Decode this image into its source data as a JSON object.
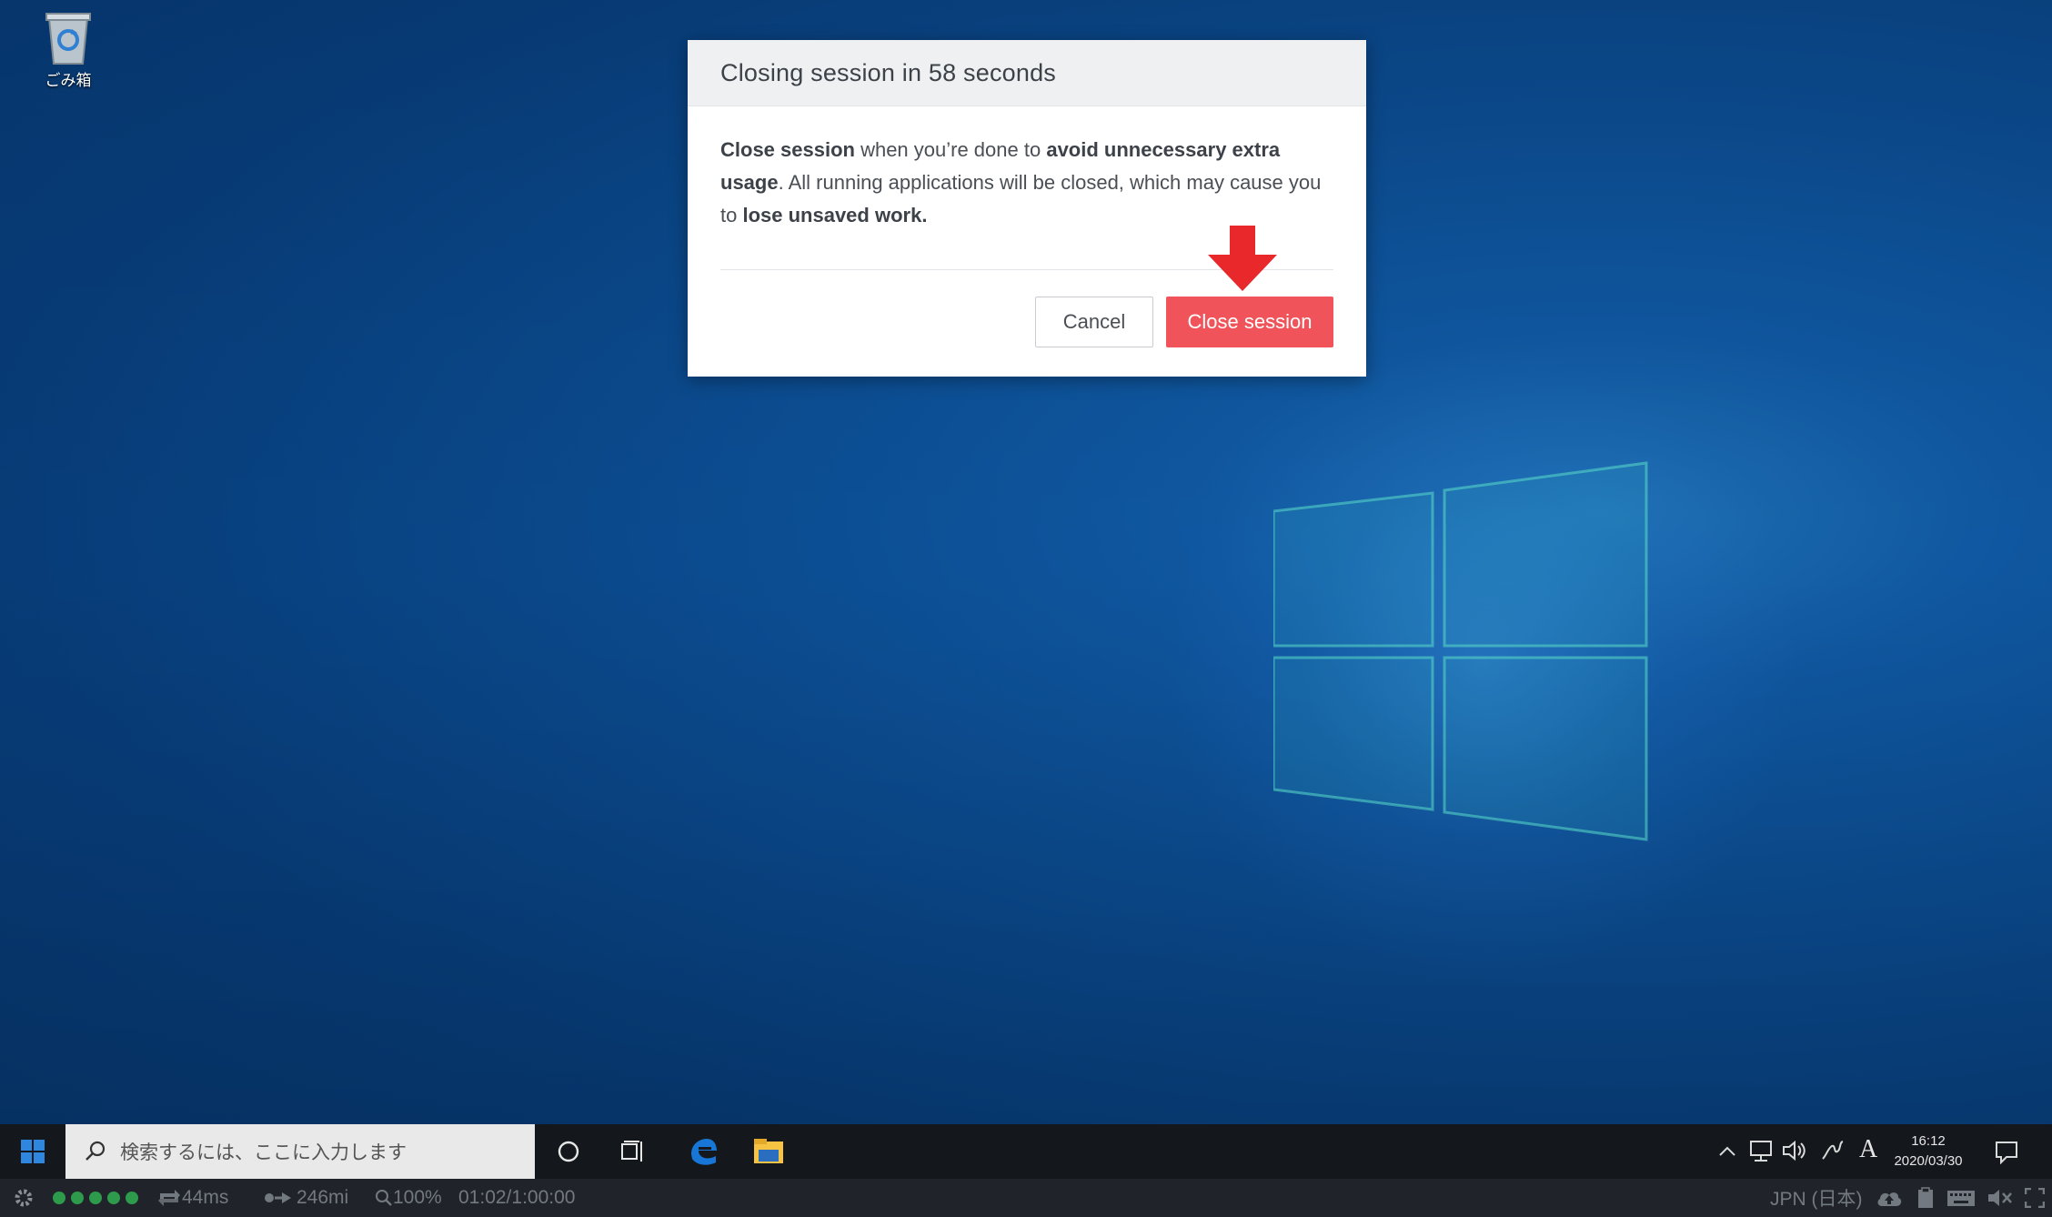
{
  "desktop": {
    "recycle_bin_label": "ごみ箱"
  },
  "dialog": {
    "title": "Closing session in 58 seconds",
    "body": {
      "p1_bold": "Close session",
      "p1_text": " when you’re done to ",
      "p2_bold": "avoid unnecessary extra usage",
      "p2_text": ". All running applications will be closed, which may cause you to ",
      "p3_bold": "lose unsaved work."
    },
    "cancel_label": "Cancel",
    "close_label": "Close session",
    "close_color": "#f0545a"
  },
  "taskbar": {
    "search_placeholder": "検索するには、ここに入力します",
    "icons": [
      "windows-start-icon",
      "search-icon",
      "cortana-icon",
      "task-view-icon",
      "edge-icon",
      "file-explorer-icon"
    ],
    "clock_time": "16:12",
    "clock_date": "2020/03/30",
    "ime_label": "A"
  },
  "statusbar": {
    "latency": "44ms",
    "distance": "246mi",
    "zoom": "100%",
    "session_time": "01:02/1:00:00",
    "language": "JPN (日本)"
  }
}
